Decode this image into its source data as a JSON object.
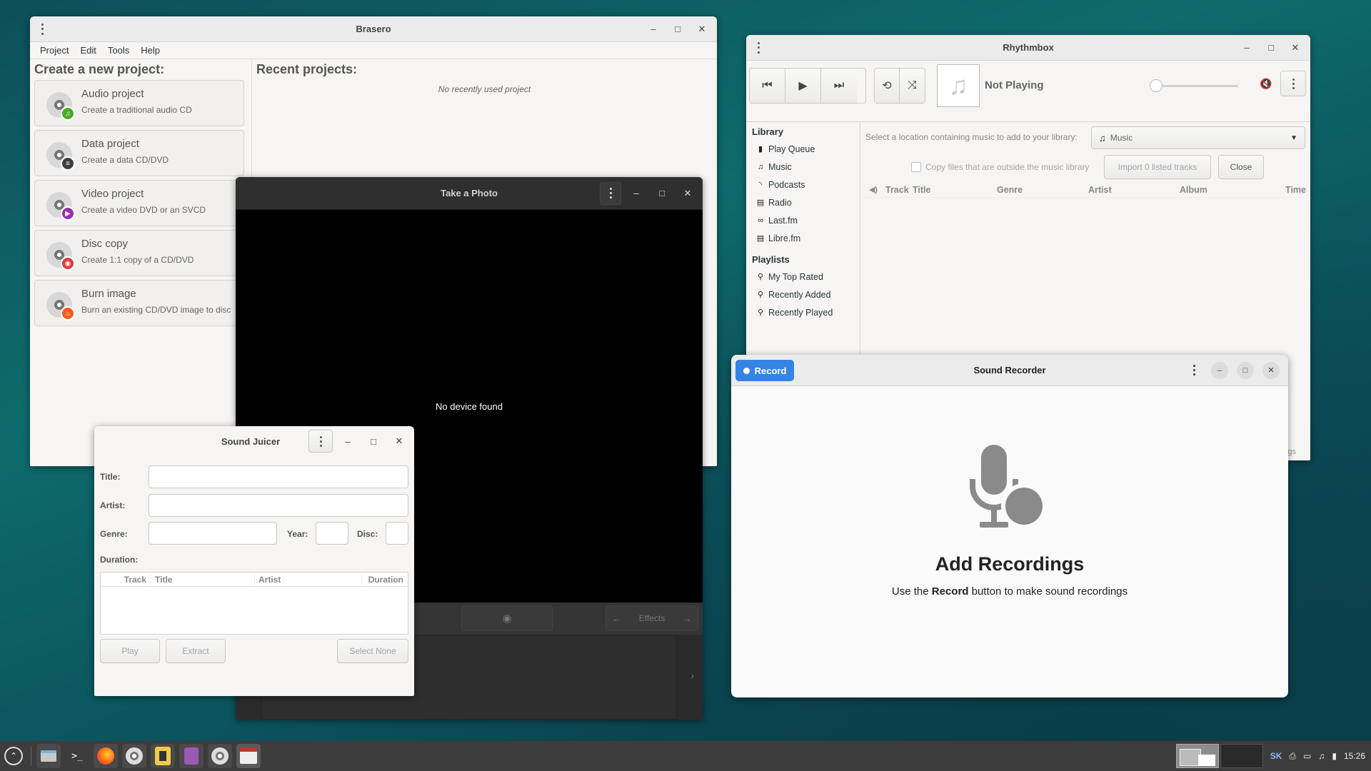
{
  "brasero": {
    "title": "Brasero",
    "menu": [
      "Project",
      "Edit",
      "Tools",
      "Help"
    ],
    "new_heading": "Create a new project:",
    "recent_heading": "Recent projects:",
    "recent_empty": "No recently used project",
    "projects": [
      {
        "title": "Audio project",
        "subtitle": "Create a traditional audio CD",
        "icon": "music-note-icon",
        "color": "#4ca92a"
      },
      {
        "title": "Data project",
        "subtitle": "Create a data CD/DVD",
        "icon": "list-icon",
        "color": "#3d3d3d"
      },
      {
        "title": "Video project",
        "subtitle": "Create a video DVD or an SVCD",
        "icon": "play-icon",
        "color": "#9b2bb4"
      },
      {
        "title": "Disc copy",
        "subtitle": "Create 1:1 copy of a CD/DVD",
        "icon": "disc-icon",
        "color": "#e0383b"
      },
      {
        "title": "Burn image",
        "subtitle": "Burn an existing CD/DVD image to disc",
        "icon": "flame-icon",
        "color": "#f05a1a"
      }
    ]
  },
  "photo": {
    "title": "Take a Photo",
    "message": "No device found",
    "effects_label": "Effects"
  },
  "juicer": {
    "title": "Sound Juicer",
    "title_label": "Title:",
    "artist_label": "Artist:",
    "genre_label": "Genre:",
    "year_label": "Year:",
    "disc_label": "Disc:",
    "duration_label": "Duration:",
    "columns": [
      "Track",
      "Title",
      "Artist",
      "Duration"
    ],
    "play": "Play",
    "extract": "Extract",
    "select_none": "Select None"
  },
  "rhythmbox": {
    "title": "Rhythmbox",
    "now_playing": "Not Playing",
    "volume": 0,
    "library_heading": "Library",
    "library": [
      {
        "label": "Play Queue",
        "icon": "queue-icon"
      },
      {
        "label": "Music",
        "icon": "music-icon"
      },
      {
        "label": "Podcasts",
        "icon": "rss-icon"
      },
      {
        "label": "Radio",
        "icon": "radio-icon"
      },
      {
        "label": "Last.fm",
        "icon": "lastfm-icon"
      },
      {
        "label": "Libre.fm",
        "icon": "librefm-icon"
      }
    ],
    "playlists_heading": "Playlists",
    "playlists": [
      "My Top Rated",
      "Recently Added",
      "Recently Played"
    ],
    "location_prompt": "Select a location containing music to add to your library:",
    "location_value": "Music",
    "copy_checkbox": "Copy files that are outside the music library",
    "import_button": "Import 0 listed tracks",
    "close_button": "Close",
    "columns": [
      "Track",
      "Title",
      "Genre",
      "Artist",
      "Album",
      "Time"
    ],
    "status_fragment": "gs"
  },
  "recorder": {
    "title": "Sound Recorder",
    "record_label": "Record",
    "empty_title": "Add Recordings",
    "empty_pre": "Use the ",
    "empty_bold": "Record",
    "empty_post": " button to make sound recordings"
  },
  "taskbar": {
    "layout": "SK",
    "clock": "15:26"
  },
  "colors": {
    "accent": "#3584e4",
    "dark_bg": "#2b2b2b"
  }
}
